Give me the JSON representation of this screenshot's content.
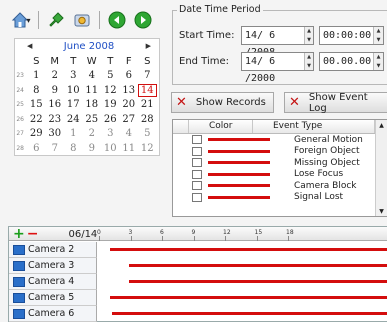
{
  "toolbar": {
    "icons": [
      "home-icon",
      "connect-icon",
      "settings-icon",
      "previous-icon",
      "next-icon"
    ]
  },
  "calendar": {
    "month_label": "June 2008",
    "dow": [
      "S",
      "M",
      "T",
      "W",
      "T",
      "F",
      "S"
    ],
    "weeks": [
      {
        "wk": "23",
        "days": [
          {
            "t": "1"
          },
          {
            "t": "2"
          },
          {
            "t": "3"
          },
          {
            "t": "4"
          },
          {
            "t": "5"
          },
          {
            "t": "6"
          },
          {
            "t": "7"
          }
        ]
      },
      {
        "wk": "24",
        "days": [
          {
            "t": "8"
          },
          {
            "t": "9"
          },
          {
            "t": "10"
          },
          {
            "t": "11"
          },
          {
            "t": "12"
          },
          {
            "t": "13"
          },
          {
            "t": "14",
            "today": true
          }
        ]
      },
      {
        "wk": "25",
        "days": [
          {
            "t": "15"
          },
          {
            "t": "16"
          },
          {
            "t": "17"
          },
          {
            "t": "18"
          },
          {
            "t": "19"
          },
          {
            "t": "20"
          },
          {
            "t": "21"
          }
        ]
      },
      {
        "wk": "26",
        "days": [
          {
            "t": "22"
          },
          {
            "t": "23"
          },
          {
            "t": "24"
          },
          {
            "t": "25"
          },
          {
            "t": "26"
          },
          {
            "t": "27"
          },
          {
            "t": "28"
          }
        ]
      },
      {
        "wk": "27",
        "days": [
          {
            "t": "29"
          },
          {
            "t": "30"
          },
          {
            "t": "1",
            "other": true
          },
          {
            "t": "2",
            "other": true
          },
          {
            "t": "3",
            "other": true
          },
          {
            "t": "4",
            "other": true
          },
          {
            "t": "5",
            "other": true
          }
        ]
      },
      {
        "wk": "28",
        "days": [
          {
            "t": "6",
            "other": true
          },
          {
            "t": "7",
            "other": true
          },
          {
            "t": "8",
            "other": true
          },
          {
            "t": "9",
            "other": true
          },
          {
            "t": "10",
            "other": true
          },
          {
            "t": "11",
            "other": true
          },
          {
            "t": "12",
            "other": true
          }
        ]
      }
    ]
  },
  "period": {
    "legend": "Date Time Period",
    "start_label": "Start Time:",
    "start_date": "14/ 6 /2008",
    "start_time": "00:00:00",
    "end_label": "End Time:",
    "end_date": "14/ 6 /2000",
    "end_time": "00.00.00"
  },
  "buttons": {
    "show_records": "Show Records",
    "show_event_log": "Show Event Log"
  },
  "events": {
    "col_color": "Color",
    "col_type": "Event Type",
    "color": "#d40d0d",
    "rows": [
      "General Motion",
      "Foreign Object",
      "Missing Object",
      "Lose Focus",
      "Camera Block",
      "Signal Lost"
    ]
  },
  "timeline": {
    "date": "06/14",
    "ticks": [
      "0",
      "3",
      "6",
      "9",
      "12",
      "15",
      "18"
    ],
    "bar_color": "#d40d0d",
    "cameras": [
      {
        "name": "Camera 2",
        "start_hour": 1.0
      },
      {
        "name": "Camera 3",
        "start_hour": 2.9
      },
      {
        "name": "Camera 4",
        "start_hour": 2.9
      },
      {
        "name": "Camera 5",
        "start_hour": 1.0
      },
      {
        "name": "Camera 6",
        "start_hour": 1.2
      }
    ]
  }
}
